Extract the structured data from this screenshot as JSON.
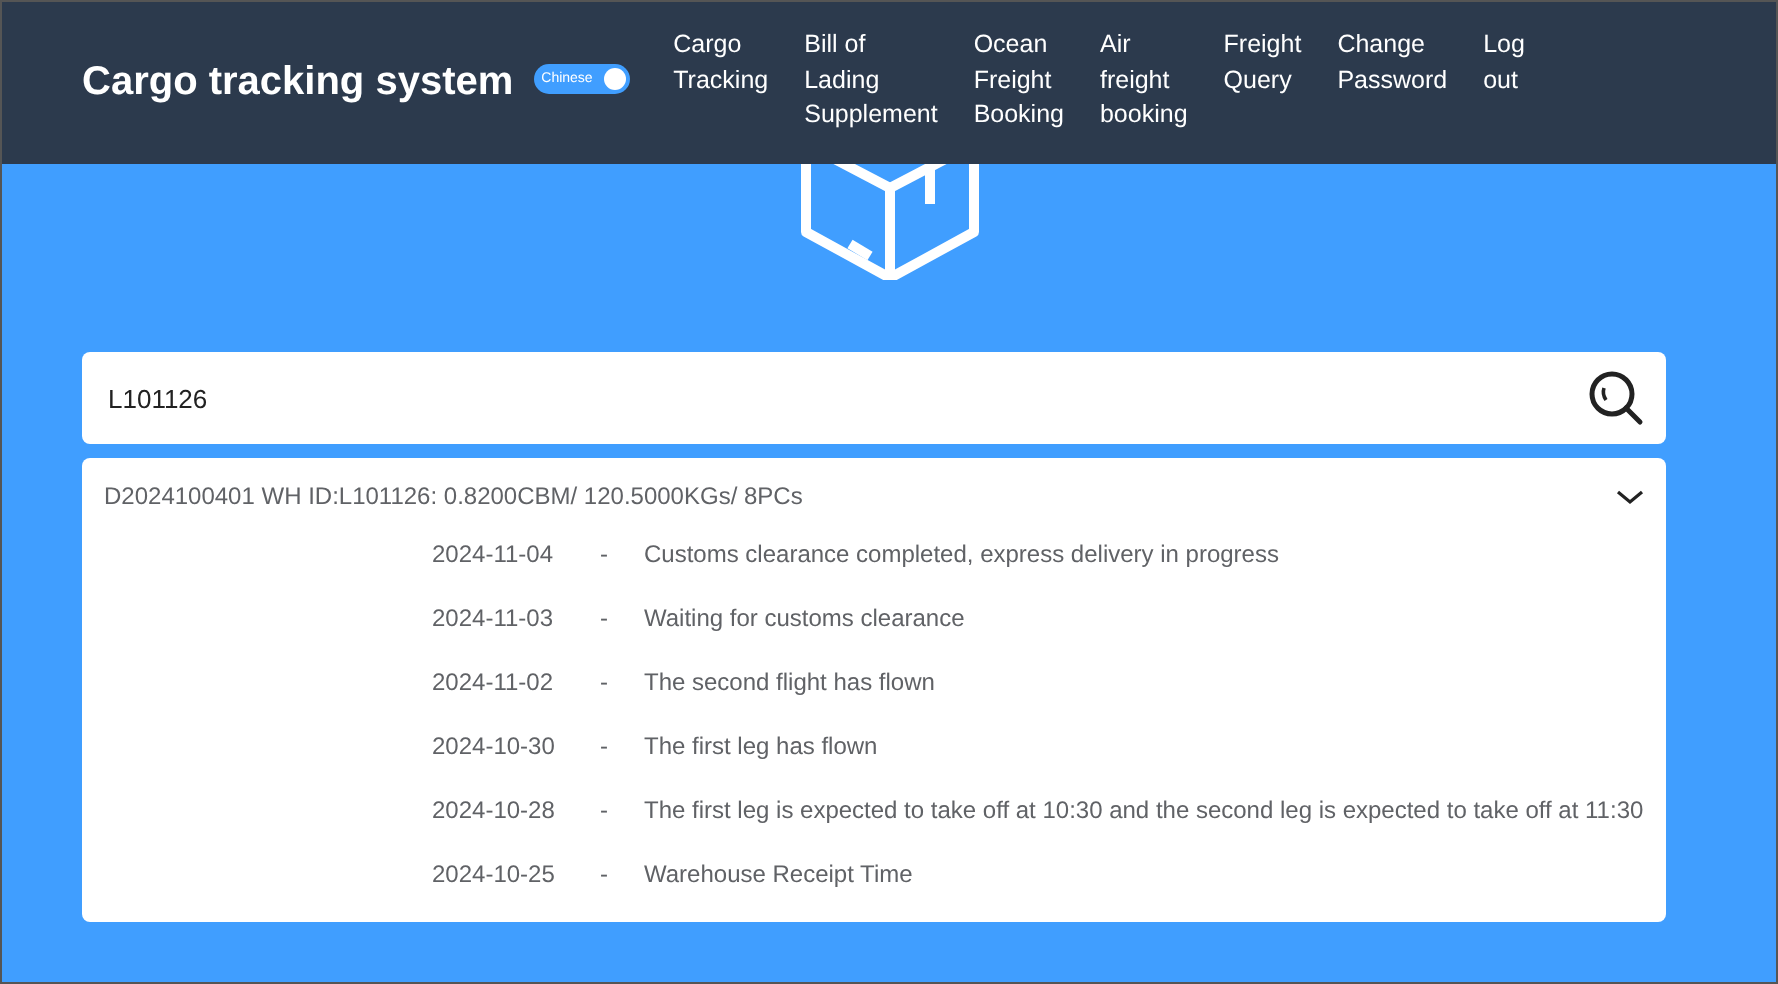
{
  "header": {
    "title": "Cargo tracking system",
    "language_toggle": {
      "label": "Chinese",
      "on": true
    },
    "nav": [
      {
        "label": "Cargo Tracking"
      },
      {
        "label": "Bill of Lading Supplement"
      },
      {
        "label": "Ocean Freight Booking"
      },
      {
        "label": "Air freight booking"
      },
      {
        "label": "Freight Query"
      },
      {
        "label": "Change Password"
      },
      {
        "label": "Log out"
      }
    ]
  },
  "search": {
    "value": "L101126"
  },
  "result": {
    "summary": "D2024100401 WH ID:L101126: 0.8200CBM/ 120.5000KGs/ 8PCs",
    "expanded": true,
    "events": [
      {
        "date": "2024-11-04",
        "separator": "-",
        "text": "Customs clearance completed, express delivery in progress"
      },
      {
        "date": "2024-11-03",
        "separator": "-",
        "text": "Waiting for customs clearance"
      },
      {
        "date": "2024-11-02",
        "separator": "-",
        "text": "The second flight has flown"
      },
      {
        "date": "2024-10-30",
        "separator": "-",
        "text": "The first leg has flown"
      },
      {
        "date": "2024-10-28",
        "separator": "-",
        "text": "The first leg is expected to take off at 10:30 and the second leg is expected to take off at 11:30"
      },
      {
        "date": "2024-10-25",
        "separator": "-",
        "text": "Warehouse Receipt Time"
      }
    ]
  }
}
